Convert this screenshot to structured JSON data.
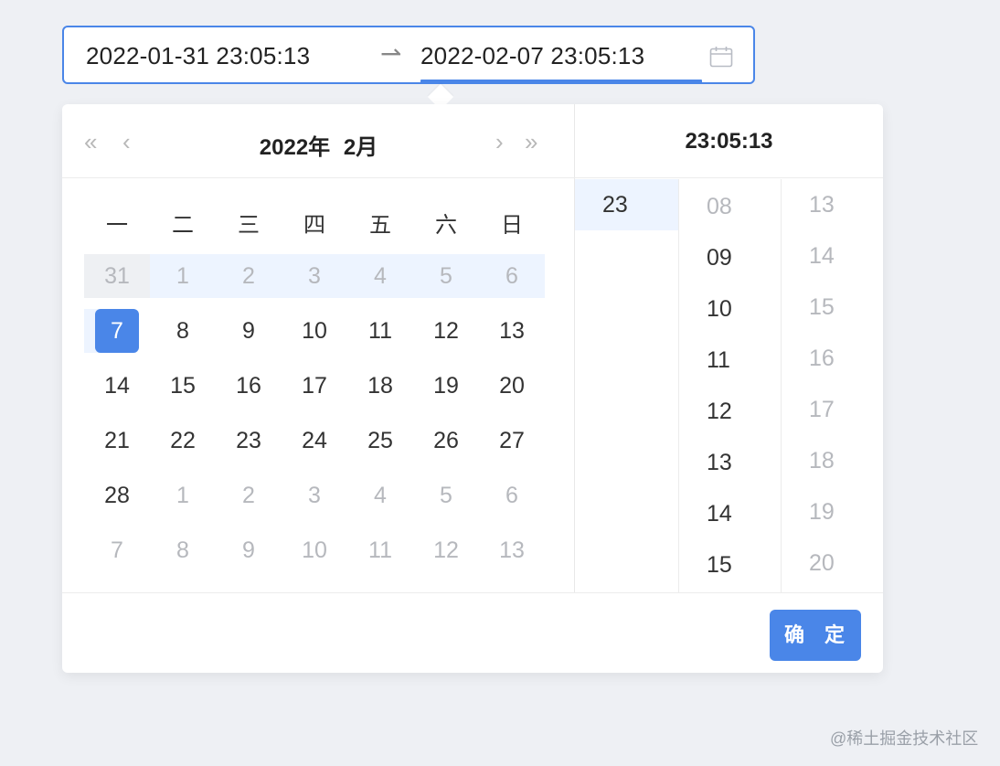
{
  "input": {
    "start_value": "2022-01-31 23:05:13",
    "end_value": "2022-02-07 23:05:13",
    "separator": "⇀"
  },
  "calendar": {
    "year_label": "2022年",
    "month_label": "2月",
    "nav": {
      "prev_year": "«",
      "prev_month": "‹",
      "next_month": "›",
      "next_year": "»"
    },
    "weekdays": [
      "一",
      "二",
      "三",
      "四",
      "五",
      "六",
      "日"
    ],
    "rows": [
      [
        "31",
        "1",
        "2",
        "3",
        "4",
        "5",
        "6"
      ],
      [
        "7",
        "8",
        "9",
        "10",
        "11",
        "12",
        "13"
      ],
      [
        "14",
        "15",
        "16",
        "17",
        "18",
        "19",
        "20"
      ],
      [
        "21",
        "22",
        "23",
        "24",
        "25",
        "26",
        "27"
      ],
      [
        "28",
        "1",
        "2",
        "3",
        "4",
        "5",
        "6"
      ],
      [
        "7",
        "8",
        "9",
        "10",
        "11",
        "12",
        "13"
      ]
    ],
    "selected_day": "7"
  },
  "time": {
    "title": "23:05:13",
    "hours": [
      "23"
    ],
    "minutes": [
      "08",
      "09",
      "10",
      "11",
      "12",
      "13",
      "14",
      "15"
    ],
    "seconds": [
      "13",
      "14",
      "15",
      "16",
      "17",
      "18",
      "19",
      "20"
    ]
  },
  "footer": {
    "ok_label": "确 定"
  },
  "watermark": "@稀土掘金技术社区",
  "colors": {
    "accent": "#4a86e8",
    "range_bg": "#edf4ff",
    "muted": "#b6b8bd"
  }
}
